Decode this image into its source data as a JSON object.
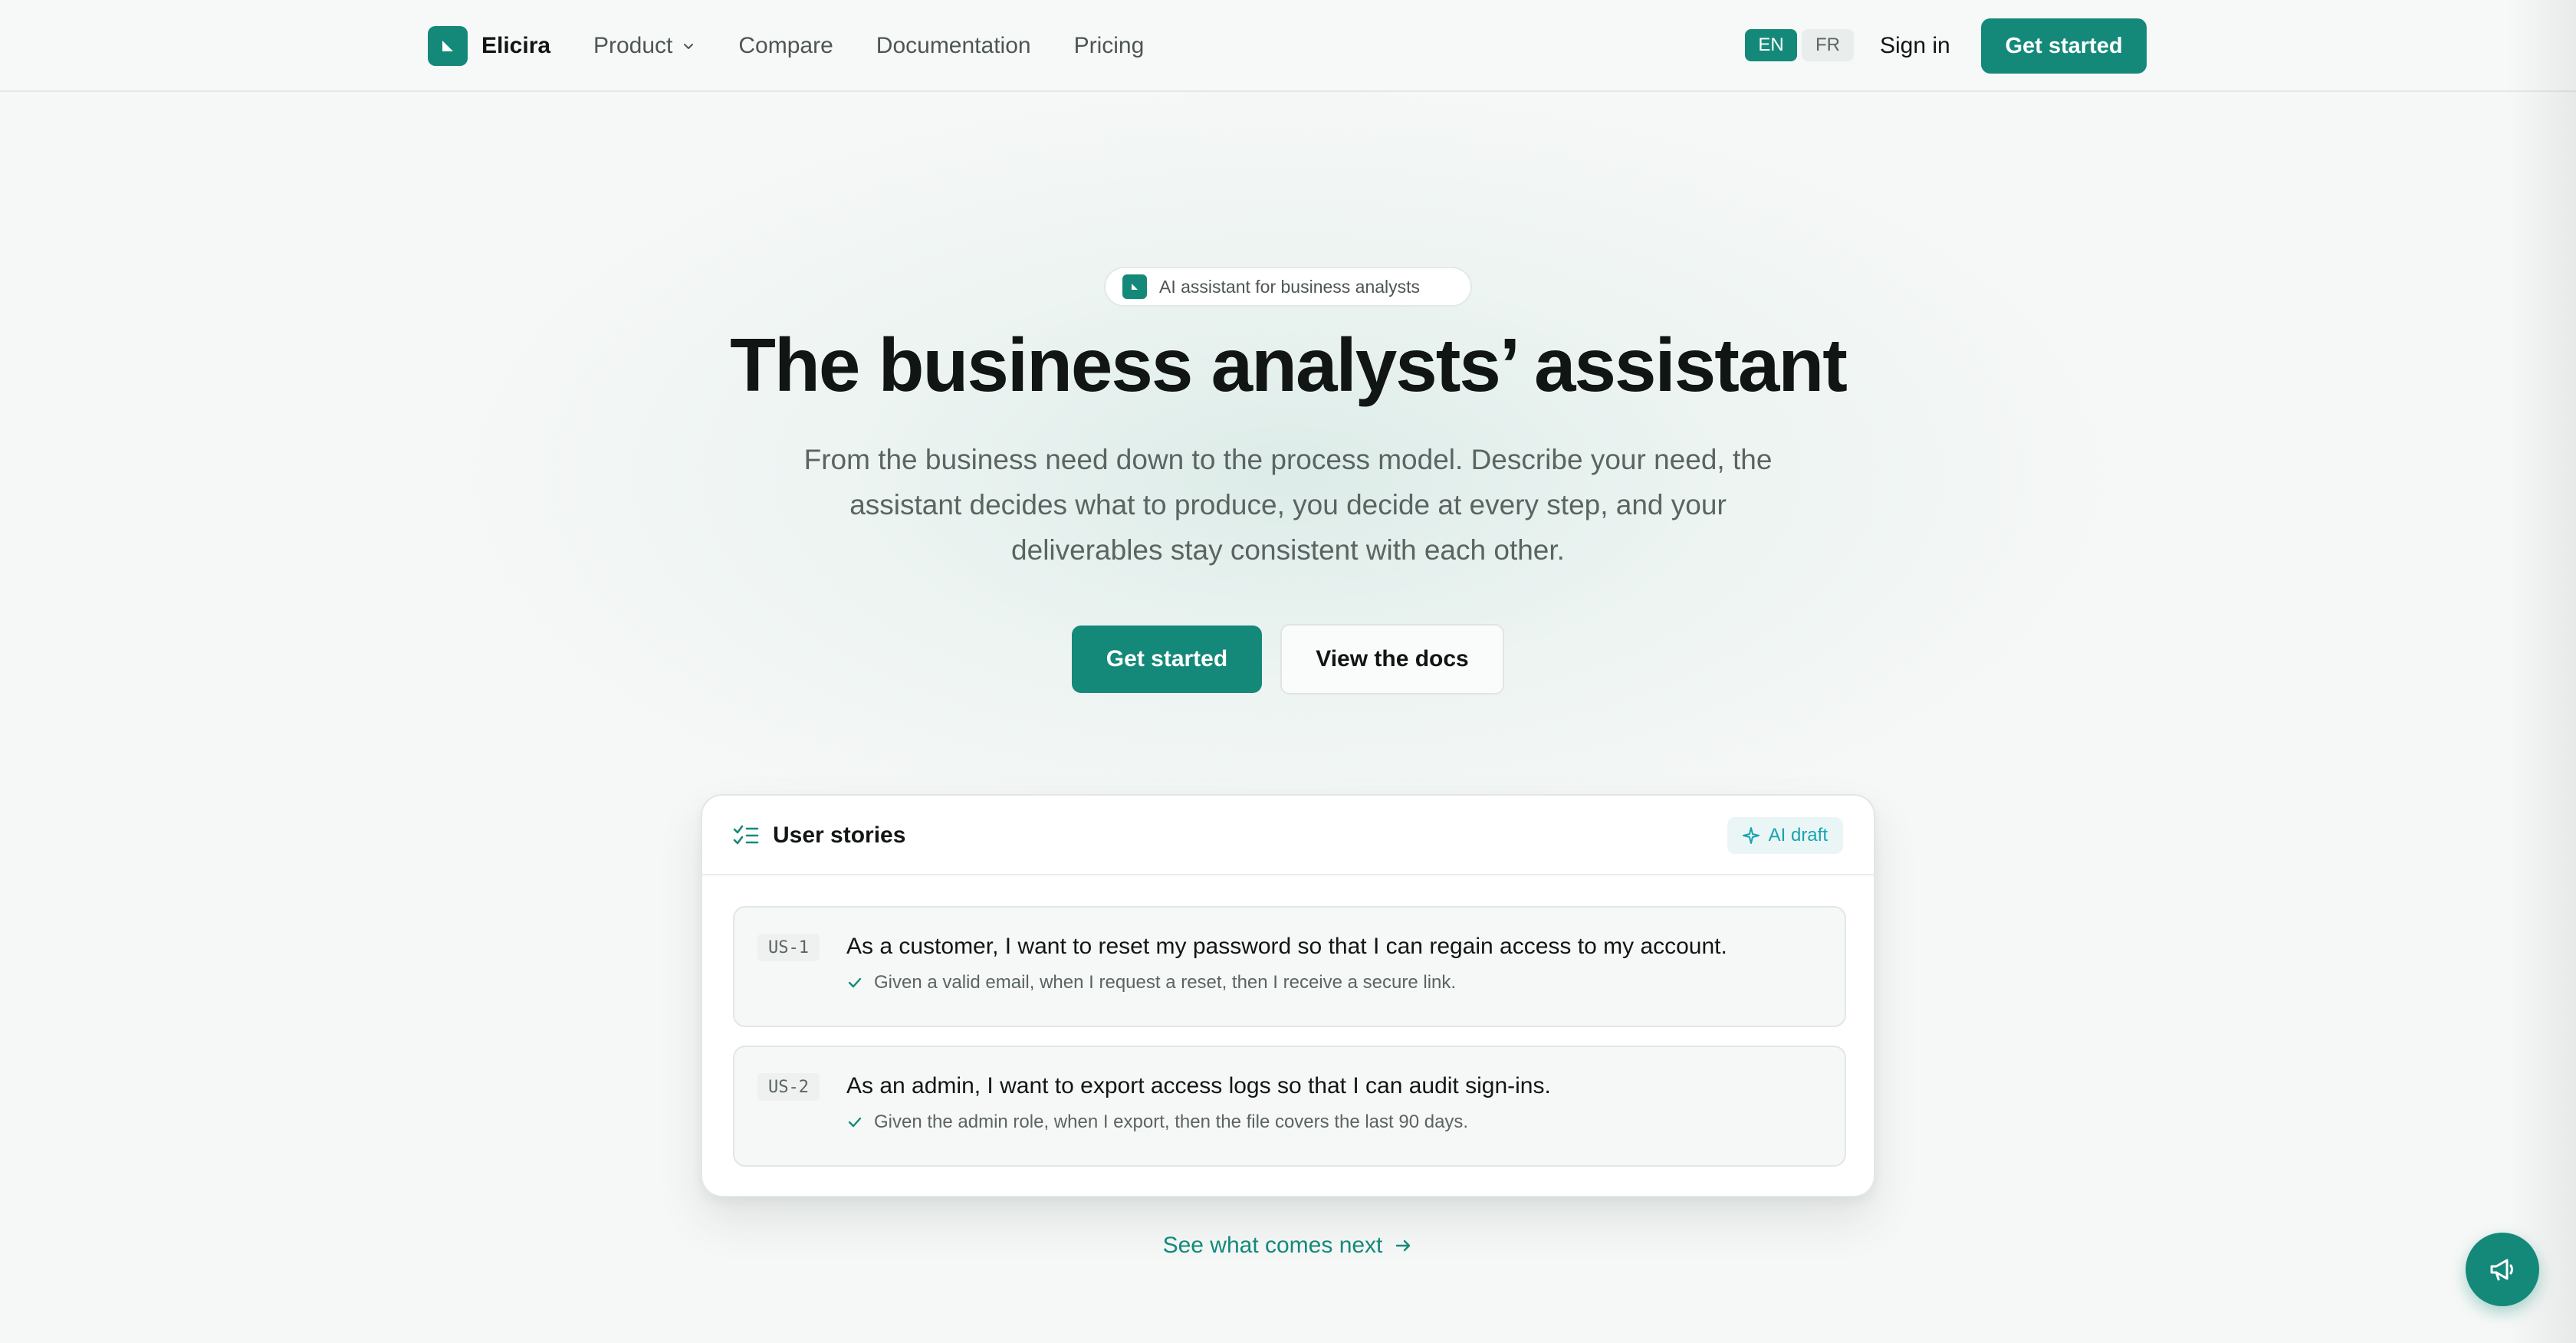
{
  "header": {
    "brand": "Elicira",
    "nav": [
      {
        "label": "Product"
      },
      {
        "label": "Compare"
      },
      {
        "label": "Documentation"
      },
      {
        "label": "Pricing"
      }
    ],
    "lang_en": "EN",
    "lang_fr": "FR",
    "sign_in": "Sign in",
    "cta": "Get started"
  },
  "hero": {
    "pill": "AI assistant for business analysts",
    "title": "The business analysts’ assistant",
    "subtitle_line1": "From the business need down to the process model. Describe your need, the",
    "subtitle_line2": "assistant decides what to produce, you decide at every step, and your",
    "subtitle_line3": "deliverables stay consistent with each other.",
    "primary_button": "Get started",
    "secondary_button": "View the docs"
  },
  "card": {
    "title": "User stories",
    "badge": "AI draft",
    "stories": [
      {
        "id": "US-1",
        "text": "As a customer, I want to reset my password so that I can regain access to my account.",
        "criteria": "Given a valid email, when I request a reset, then I receive a secure link."
      },
      {
        "id": "US-2",
        "text": "As an admin, I want to export access logs so that I can audit sign-ins.",
        "criteria": "Given the admin role, when I export, then the file covers the last 90 days."
      }
    ]
  },
  "next_link": "See what comes next",
  "colors": {
    "accent": "#14897a",
    "ai_badge": "#17a3b3",
    "background": "#f6f8f7"
  }
}
